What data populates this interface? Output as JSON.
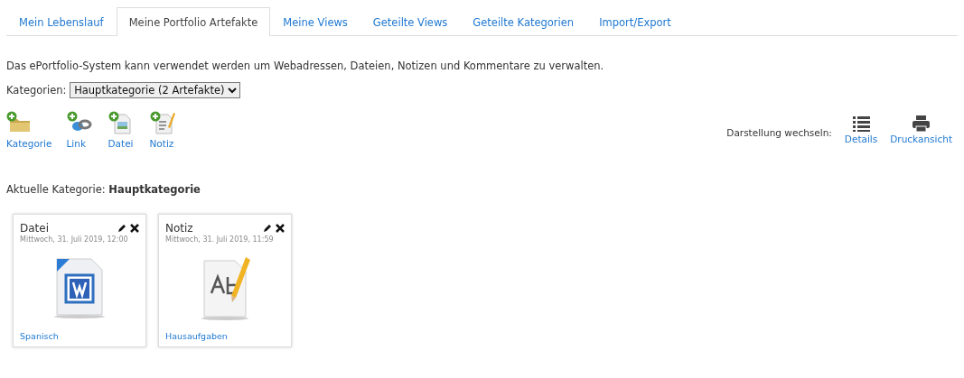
{
  "tabs": [
    {
      "label": "Mein Lebenslauf",
      "selected": false
    },
    {
      "label": "Meine Portfolio Artefakte",
      "selected": true
    },
    {
      "label": "Meine Views",
      "selected": false
    },
    {
      "label": "Geteilte Views",
      "selected": false
    },
    {
      "label": "Geteilte Kategorien",
      "selected": false
    },
    {
      "label": "Import/Export",
      "selected": false
    }
  ],
  "intro": "Das ePortfolio-System kann verwendet werden um Webadressen, Dateien, Notizen und Kommentare zu verwalten.",
  "category_select": {
    "label": "Kategorien:",
    "value": "Hauptkategorie (2 Artefakte)"
  },
  "add_actions": [
    {
      "kind": "folder",
      "label": "Kategorie"
    },
    {
      "kind": "link",
      "label": "Link"
    },
    {
      "kind": "file",
      "label": "Datei"
    },
    {
      "kind": "note",
      "label": "Notiz"
    }
  ],
  "view_switch": {
    "label": "Darstellung wechseln:",
    "options": [
      {
        "kind": "list",
        "label": "Details"
      },
      {
        "kind": "print",
        "label": "Druckansicht"
      }
    ]
  },
  "current_category": "Aktuelle Kategorie: **Hauptkategorie**",
  "artifacts": [
    {
      "kind": "word",
      "title": "Datei",
      "date": "Mittwoch, 31. Juli 2019, 12:00",
      "tag": "Spanisch"
    },
    {
      "kind": "note",
      "title": "Notiz",
      "date": "Mittwoch, 31. Juli 2019, 11:59",
      "tag": "Hausaufgaben"
    }
  ]
}
